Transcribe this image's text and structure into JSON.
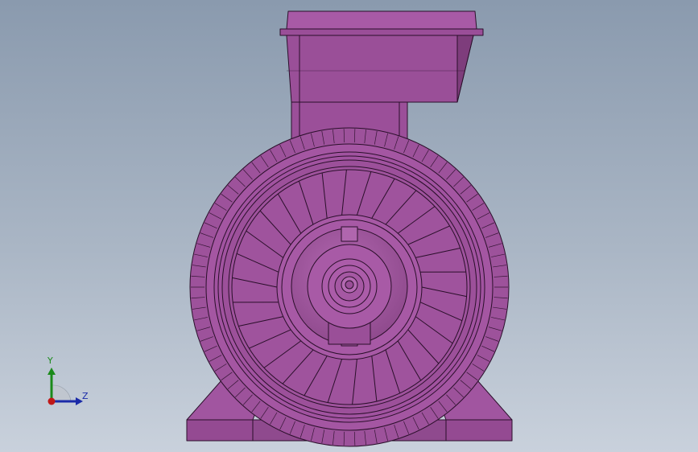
{
  "viewport": {
    "background_top": "#8a9aae",
    "background_bottom": "#c9d1dc"
  },
  "model": {
    "part_color": "#9e4f9c",
    "edge_color": "#2a0f2a",
    "object": "electric-motor-front-view"
  },
  "triad": {
    "y_label": "Y",
    "z_label": "Z",
    "y_color": "#1a8a1a",
    "z_color": "#1a2aa8",
    "x_color": "#c01818"
  }
}
